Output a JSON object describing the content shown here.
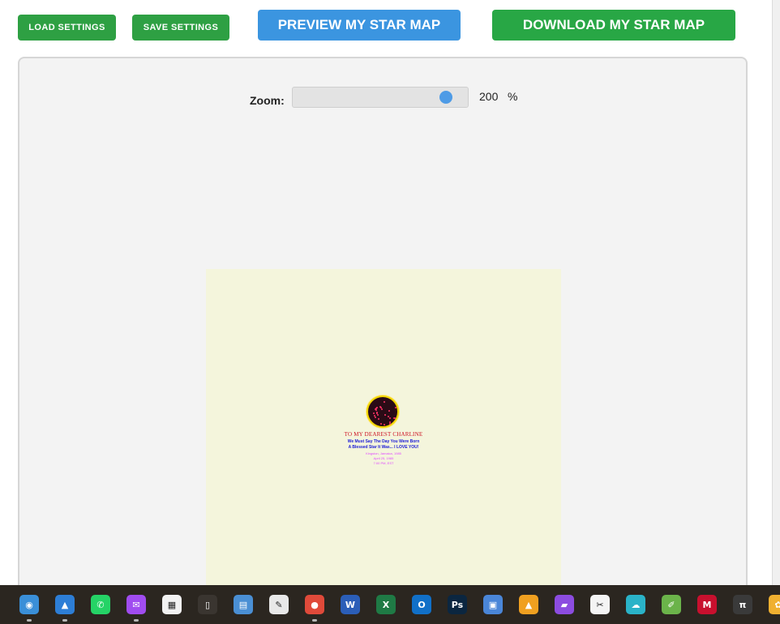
{
  "toolbar": {
    "load_label": "LOAD SETTINGS",
    "save_label": "SAVE SETTINGS",
    "preview_label": "PREVIEW MY STAR MAP",
    "download_label": "DOWNLOAD MY STAR MAP"
  },
  "zoom": {
    "label": "Zoom:",
    "value": "200",
    "unit": "%",
    "slider_fraction": 0.92
  },
  "poster": {
    "title": "TO MY DEAREST CHARLINE",
    "line1": "We Must Say The Day You Were Born",
    "line2": "A Blessed Star It Was... I LOVE YOU!",
    "small1": "Kingston, Jamaica, 1985",
    "small2": "April 25, 1985",
    "small3": "7:00 PM, EST"
  },
  "taskbar": {
    "icons": [
      {
        "name": "globe-app-icon",
        "glyph": "◉",
        "color": "#3a8fd8"
      },
      {
        "name": "photos-icon",
        "glyph": "▲",
        "color": "#2d7ed6"
      },
      {
        "name": "whatsapp-icon",
        "glyph": "✆",
        "color": "#25d366"
      },
      {
        "name": "messenger-icon",
        "glyph": "✉",
        "color": "#a04cf0"
      },
      {
        "name": "microsoft-store-icon",
        "glyph": "▦",
        "color": "#f2f2f2"
      },
      {
        "name": "task-view-icon",
        "glyph": "▯",
        "color": "#3a3530"
      },
      {
        "name": "control-panel-icon",
        "glyph": "▤",
        "color": "#4a8fd4"
      },
      {
        "name": "editor-app-icon",
        "glyph": "✎",
        "color": "#e8e8e8"
      },
      {
        "name": "chrome-icon",
        "glyph": "●",
        "color": "#e04a3a"
      },
      {
        "name": "word-icon",
        "glyph": "W",
        "color": "#2b5eb8"
      },
      {
        "name": "excel-icon",
        "glyph": "X",
        "color": "#1f7a45"
      },
      {
        "name": "outlook-icon",
        "glyph": "O",
        "color": "#1170c8"
      },
      {
        "name": "photoshop-icon",
        "glyph": "Ps",
        "color": "#0b2640"
      },
      {
        "name": "file-app-icon",
        "glyph": "▣",
        "color": "#4a86d8"
      },
      {
        "name": "affinity-icon",
        "glyph": "▲",
        "color": "#f0a020"
      },
      {
        "name": "clapper-icon",
        "glyph": "▰",
        "color": "#8c4ce0"
      },
      {
        "name": "capcut-icon",
        "glyph": "✂",
        "color": "#f4f4f4"
      },
      {
        "name": "cloud-app-icon",
        "glyph": "☁",
        "color": "#2ab3c8"
      },
      {
        "name": "notepad-icon",
        "glyph": "✐",
        "color": "#6bb34a"
      },
      {
        "name": "mcafee-icon",
        "glyph": "M",
        "color": "#c8102e"
      },
      {
        "name": "pi-app-icon",
        "glyph": "π",
        "color": "#3a3a3a"
      },
      {
        "name": "paint-app-icon",
        "glyph": "✿",
        "color": "#f0b030"
      }
    ]
  }
}
